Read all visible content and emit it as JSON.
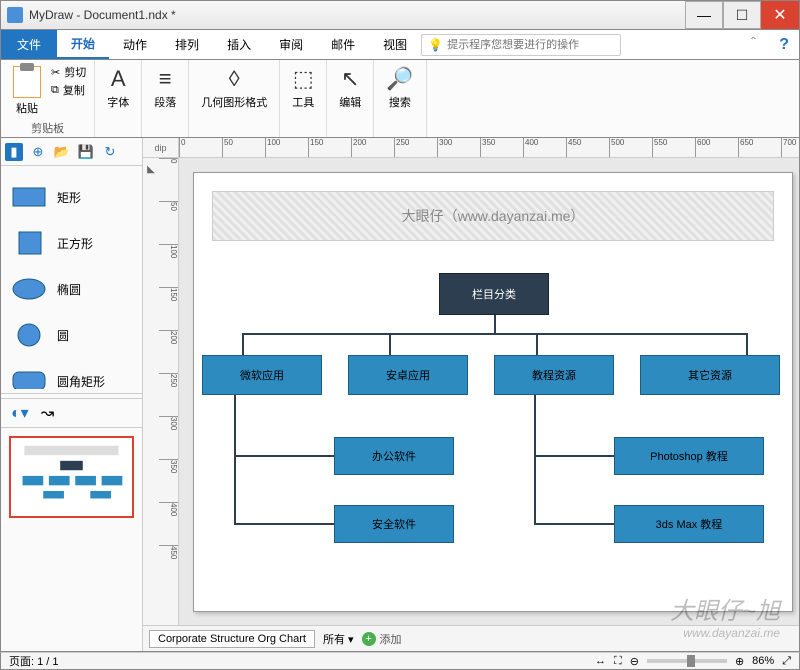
{
  "window": {
    "title": "MyDraw - Document1.ndx *",
    "min": "—",
    "max": "☐",
    "close": "✕"
  },
  "tabs": {
    "file": "文件",
    "items": [
      "开始",
      "动作",
      "排列",
      "插入",
      "审阅",
      "邮件",
      "视图"
    ],
    "search_placeholder": "提示程序您想要进行的操作",
    "help": "?"
  },
  "ribbon": {
    "clipboard": {
      "paste": "粘贴",
      "cut": "剪切",
      "copy": "复制",
      "label": "剪贴板"
    },
    "font": {
      "btn": "A",
      "label": "字体"
    },
    "paragraph": {
      "label": "段落"
    },
    "geometry": {
      "label": "几何图形格式"
    },
    "tools": {
      "label": "工具"
    },
    "edit": {
      "label": "编辑"
    },
    "search": {
      "label": "搜索"
    }
  },
  "shapes": {
    "corner_label": "dip",
    "items": [
      {
        "name": "矩形",
        "type": "rect"
      },
      {
        "name": "正方形",
        "type": "square"
      },
      {
        "name": "椭圆",
        "type": "ellipse"
      },
      {
        "name": "圆",
        "type": "circle"
      },
      {
        "name": "圆角矩形",
        "type": "roundrect"
      }
    ]
  },
  "ruler": {
    "h": [
      "0",
      "50",
      "100",
      "150",
      "200",
      "250",
      "300",
      "350",
      "400",
      "450",
      "500",
      "550",
      "600",
      "650",
      "700"
    ],
    "v": [
      "0",
      "50",
      "100",
      "150",
      "200",
      "250",
      "300",
      "350",
      "400",
      "450"
    ]
  },
  "diagram": {
    "banner": "大眼仔（www.dayanzai.me）",
    "root": "栏目分类",
    "level1": [
      "微软应用",
      "安卓应用",
      "教程资源",
      "其它资源"
    ],
    "children_left": [
      "办公软件",
      "安全软件"
    ],
    "children_right": [
      "Photoshop 教程",
      "3ds Max 教程"
    ]
  },
  "pagetabs": {
    "current": "Corporate Structure Org Chart",
    "all": "所有 ▾",
    "add": "添加"
  },
  "status": {
    "page": "页面: 1 / 1",
    "zoom": "86%"
  },
  "watermark": {
    "big": "大眼仔~旭",
    "small": "www.dayanzai.me"
  }
}
